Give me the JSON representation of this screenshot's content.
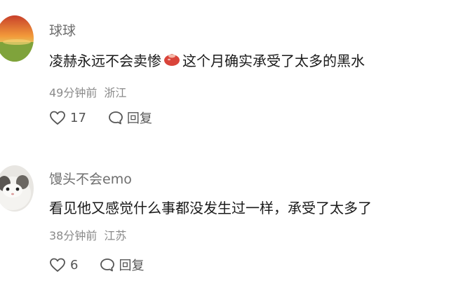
{
  "comments": [
    {
      "username": "球球",
      "text_before_emoji": "凌赫永远不会卖惨",
      "emoji_icon": "red-bag-emoji-icon",
      "text_after_emoji": "这个月确实承受了太多的黑水",
      "time": "49分钟前",
      "location": "浙江",
      "likes": "17",
      "reply_label": "回复"
    },
    {
      "username": "馒头不会emo",
      "text": "看见他又感觉什么事都没发生过一样，承受了太多了",
      "time": "38分钟前",
      "location": "江苏",
      "likes": "6",
      "reply_label": "回复"
    }
  ],
  "colors": {
    "username": "#6e6e6e",
    "body_text": "#1a1a1a",
    "meta_text": "#8a8a8a",
    "icon": "#555555"
  }
}
